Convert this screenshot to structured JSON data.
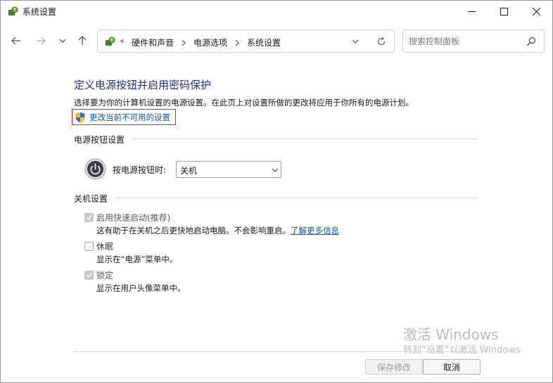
{
  "window": {
    "title": "系统设置"
  },
  "address": {
    "prefix": "«",
    "crumbs": [
      "硬件和声音",
      "电源选项",
      "系统设置"
    ]
  },
  "search": {
    "placeholder": "搜索控制面板"
  },
  "content": {
    "heading": "定义电源按钮并启用密码保护",
    "description": "选择要为你的计算机设置的电源设置。在此页上对设置所做的更改将应用于你所有的电源计划。",
    "change_link": "更改当前不可用的设置"
  },
  "power_section": {
    "label": "电源按钮设置",
    "button_label": "按电源按钮时:",
    "selected": "关机"
  },
  "shutdown_section": {
    "label": "关机设置",
    "fast_startup": {
      "title": "启用快速启动(推荐)",
      "desc": "这有助于在关机之后更快地启动电脑。不会影响重启。",
      "link": "了解更多信息",
      "checked": true
    },
    "hibernate": {
      "title": "休眠",
      "desc": "显示在“电源”菜单中。",
      "checked": false
    },
    "lock": {
      "title": "锁定",
      "desc": "显示在用户头像菜单中。",
      "checked": true
    }
  },
  "watermark": {
    "title": "激活 Windows",
    "subtitle": "转到“设置”以激活 Windows"
  },
  "footer": {
    "save_label": "保存修改",
    "cancel_label": "取消"
  },
  "colors": {
    "heading": "#1e3287",
    "link": "#0b58bd",
    "highlight_border": "#d81e1e"
  }
}
